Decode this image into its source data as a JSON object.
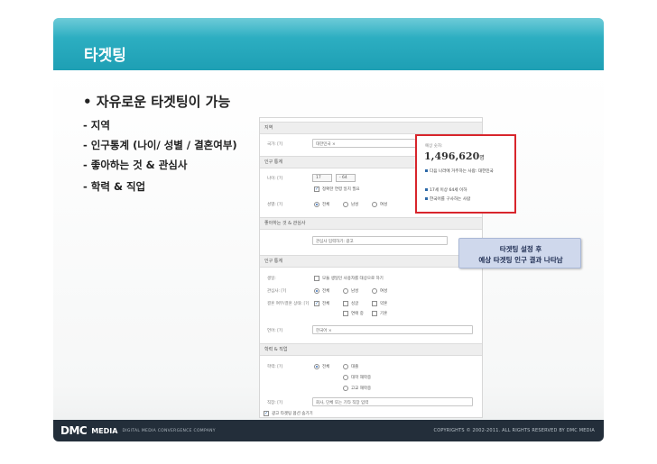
{
  "slide": {
    "title": "타겟팅",
    "bullet": "• 자유로운 타겟팅이 가능",
    "items": [
      "- 지역",
      "- 인구통계 (나이/ 성별 / 결혼여부)",
      "- 좋아하는 것 & 관심사",
      "- 학력 & 직업"
    ]
  },
  "panel": {
    "sections": [
      "지역",
      "인구 통계",
      "좋아하는 것 & 관심사",
      "인구 통계",
      "학력 & 직업"
    ],
    "location": {
      "label": "국가: [?]",
      "value": "대한민국 ×"
    },
    "age": {
      "label": "나이: [?]",
      "from": "17",
      "sep": "- 64",
      "exact_check": "정확한 연령 일치 필요"
    },
    "gender": {
      "label": "성별: [?]",
      "options": [
        "전체",
        "남성",
        "여성"
      ]
    },
    "interest": {
      "label": "관심사 입력하기:",
      "value": "관심사 입력하기: 광고"
    },
    "demo2": {
      "birthday_label": "생일:",
      "birthday_check": "모듈 생일인 사용자를 대상으로 하기",
      "interested_label": "관심사: [?]",
      "interested_opts": [
        "전체",
        "남성",
        "여성"
      ],
      "relationship_label": "결혼 여부/결혼 상태: [?]",
      "relationship_opts": [
        "전체",
        "싱글",
        "약혼",
        "연애 중",
        "기혼"
      ],
      "language_label": "언어: [?]",
      "language_value": "한국어 ×"
    },
    "education": {
      "label": "학력: [?]",
      "opts": [
        "전체",
        "대졸",
        "대학 재학중",
        "고교 재학중"
      ],
      "work_label": "직장: [?]",
      "work_value": "회사, 단체 또는 기타 직장 입력",
      "footer_check": "광고 타겟팅 옵션 숨기기"
    }
  },
  "estimate": {
    "label": "예상 숫자:",
    "reach": "1,496,620",
    "unit": "명",
    "rows": [
      "다음 나라에 거주하는 사람: 대한민국",
      "17세 이상 64세 이하",
      "한국어를 구사하는 사람"
    ]
  },
  "note": {
    "line1": "타겟팅 설정 후",
    "line2": "예상 타겟팅 인구 결과 나타남"
  },
  "footer": {
    "logo_dmc": "DMC",
    "logo_media": "MEDIA",
    "tagline": "DIGITAL MEDIA CONVERGENCE COMPANY",
    "copyright": "COPYRIGHTS © 2002-2011. ALL RIGHTS RESERVED BY DMC MEDIA"
  },
  "colors": {
    "accent": "#1e9fb4",
    "highlight": "#d8252c",
    "footer_bg": "#232e3a"
  }
}
